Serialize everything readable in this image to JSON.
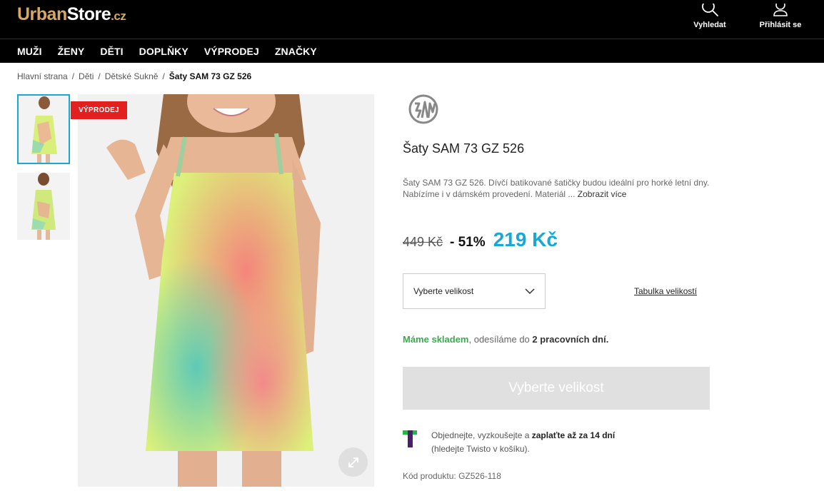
{
  "header": {
    "logo": {
      "part1": "Urban",
      "part2": "Store",
      "part3": ".cz"
    },
    "search_label": "Vyhledat",
    "login_label": "Přihlásit se",
    "colors": {
      "background": "#000000",
      "logo_accent": "#d8a860"
    }
  },
  "nav": {
    "items": [
      {
        "label": "MUŽI"
      },
      {
        "label": "ŽENY"
      },
      {
        "label": "DĚTI"
      },
      {
        "label": "DOPLŇKY"
      },
      {
        "label": "VÝPRODEJ"
      },
      {
        "label": "ZNAČKY"
      }
    ]
  },
  "breadcrumb": {
    "items": [
      {
        "label": "Hlavní strana"
      },
      {
        "label": "Děti"
      },
      {
        "label": "Dětské Sukně"
      }
    ],
    "current": "Šaty SAM 73 GZ 526",
    "separator": "/"
  },
  "gallery": {
    "badge": "VÝPRODEJ",
    "badge_color": "#e32020"
  },
  "product": {
    "title": "Šaty SAM 73 GZ 526",
    "description": "Šaty SAM 73 GZ 526. Dívčí batikované šatičky budou ideální pro horké letní dny. Nabízíme i v dámském provedení. Materiál ...",
    "more_link": "Zobrazit více",
    "old_price": "449 Kč",
    "discount": "- 51%",
    "price": "219 Kč",
    "price_color": "#19a7d6",
    "size_placeholder": "Vyberte velikost",
    "size_table_link": "Tabulka velikostí",
    "stock_ok": "Máme skladem",
    "stock_mid": ", odesíláme do ",
    "stock_days": "2 pracovních dní",
    "stock_end": ".",
    "stock_color": "#3aaa4c",
    "cta_label": "Vyberte velikost",
    "twisto_text1": "Objednejte, vyzkoušejte a ",
    "twisto_bold": "zaplaťte až za 14 dní",
    "twisto_text2": "(hledejte Twisto v košíku).",
    "code_label": "Kód produktu:",
    "code_value": "GZ526-118"
  }
}
